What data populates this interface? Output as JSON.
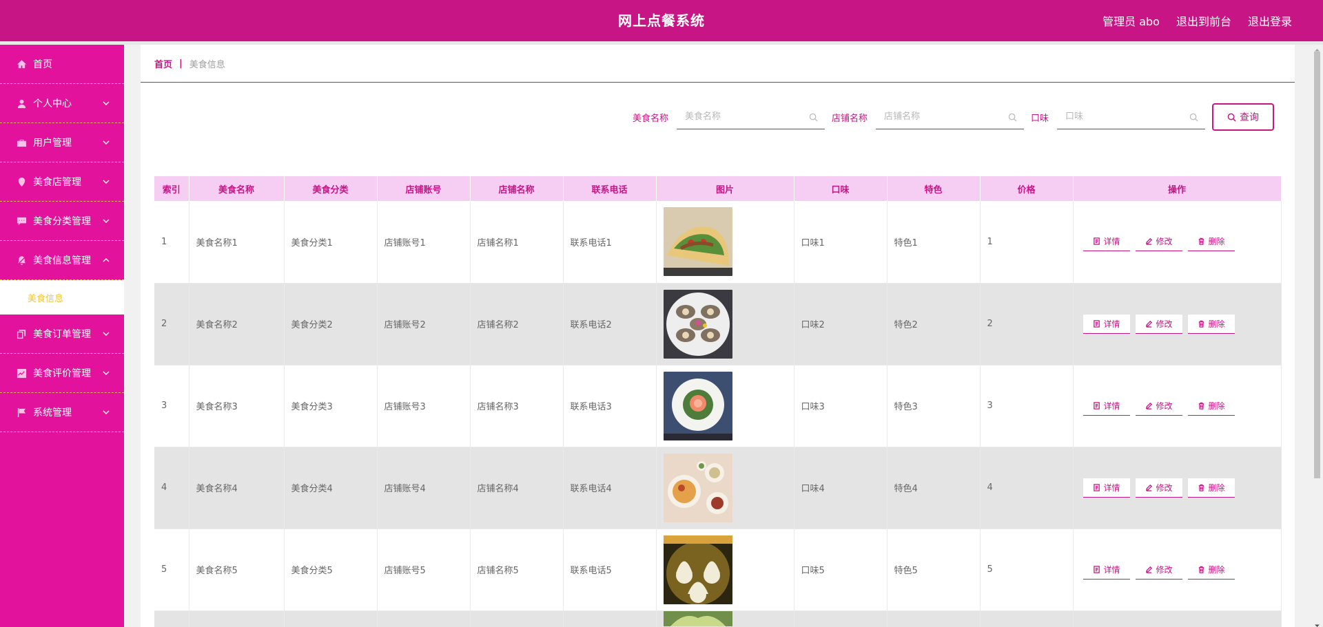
{
  "header": {
    "title": "网上点餐系统",
    "admin_label": "管理员 abo",
    "to_front_label": "退出到前台",
    "logout_label": "退出登录"
  },
  "sidebar": {
    "items": [
      {
        "label": "首页",
        "icon": "home-icon"
      },
      {
        "label": "个人中心",
        "icon": "user-icon"
      },
      {
        "label": "用户管理",
        "icon": "briefcase-icon"
      },
      {
        "label": "美食店管理",
        "icon": "location-icon"
      },
      {
        "label": "美食分类管理",
        "icon": "chat-icon"
      },
      {
        "label": "美食信息管理",
        "icon": "bell-off-icon"
      },
      {
        "label": "美食订单管理",
        "icon": "copy-icon"
      },
      {
        "label": "美食评价管理",
        "icon": "chart-icon"
      },
      {
        "label": "系统管理",
        "icon": "flag-icon"
      }
    ],
    "submenu_label": "美食信息"
  },
  "breadcrumb": {
    "home": "首页",
    "separator": "|",
    "current": "美食信息"
  },
  "search": {
    "food_name_label": "美食名称",
    "food_name_placeholder": "美食名称",
    "shop_name_label": "店铺名称",
    "shop_name_placeholder": "店铺名称",
    "taste_label": "口味",
    "taste_placeholder": "口味",
    "query_label": "查询"
  },
  "table": {
    "columns": [
      "索引",
      "美食名称",
      "美食分类",
      "店铺账号",
      "店铺名称",
      "联系电话",
      "图片",
      "口味",
      "特色",
      "价格",
      "操作"
    ],
    "rows": [
      {
        "index": "1",
        "name": "美食名称1",
        "category": "美食分类1",
        "account": "店铺账号1",
        "shop": "店铺名称1",
        "phone": "联系电话1",
        "taste": "口味1",
        "feature": "特色1",
        "price": "1"
      },
      {
        "index": "2",
        "name": "美食名称2",
        "category": "美食分类2",
        "account": "店铺账号2",
        "shop": "店铺名称2",
        "phone": "联系电话2",
        "taste": "口味2",
        "feature": "特色2",
        "price": "2"
      },
      {
        "index": "3",
        "name": "美食名称3",
        "category": "美食分类3",
        "account": "店铺账号3",
        "shop": "店铺名称3",
        "phone": "联系电话3",
        "taste": "口味3",
        "feature": "特色3",
        "price": "3"
      },
      {
        "index": "4",
        "name": "美食名称4",
        "category": "美食分类4",
        "account": "店铺账号4",
        "shop": "店铺名称4",
        "phone": "联系电话4",
        "taste": "口味4",
        "feature": "特色4",
        "price": "4"
      },
      {
        "index": "5",
        "name": "美食名称5",
        "category": "美食分类5",
        "account": "店铺账号5",
        "shop": "店铺名称5",
        "phone": "联系电话5",
        "taste": "口味5",
        "feature": "特色5",
        "price": "5"
      }
    ],
    "actions": {
      "detail": "详情",
      "edit": "修改",
      "delete": "删除"
    }
  },
  "colors": {
    "primary": "#c71585",
    "sidebar": "#e2129c",
    "table_header": "#f6cef4",
    "submenu_text": "#f0c83a",
    "divider": "#f5c25b"
  }
}
